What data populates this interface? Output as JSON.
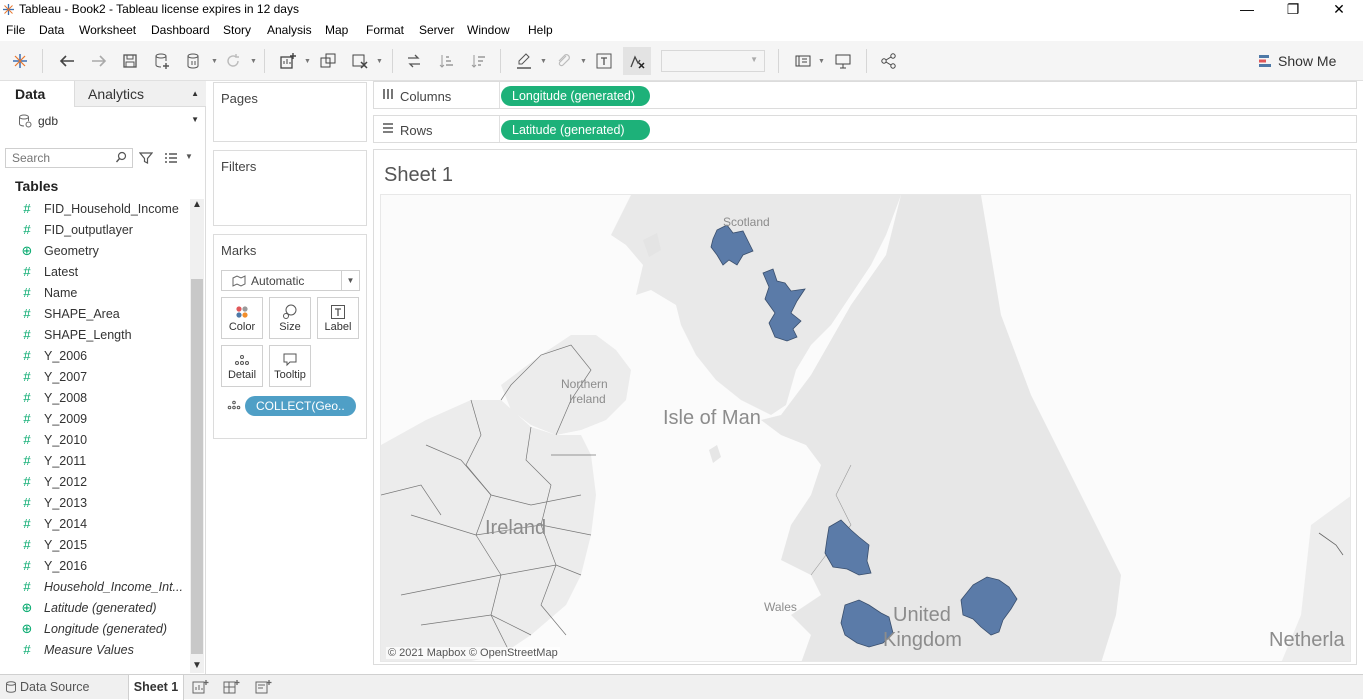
{
  "window": {
    "title": "Tableau - Book2 - Tableau license expires in 12 days",
    "minimize": "—",
    "maximize": "❐",
    "close": "✕"
  },
  "menu": [
    "File",
    "Data",
    "Worksheet",
    "Dashboard",
    "Story",
    "Analysis",
    "Map",
    "Format",
    "Server",
    "Window",
    "Help"
  ],
  "toolbar": {
    "show_me": "Show Me",
    "icons": [
      "tableau-logo-icon",
      "undo-icon",
      "redo-icon",
      "save-icon",
      "new-datasource-icon",
      "pause-updates-icon",
      "refresh-icon",
      "new-worksheet-icon",
      "duplicate-sheet-icon",
      "clear-sheet-icon",
      "swap-rows-columns-icon",
      "sort-ascending-icon",
      "sort-descending-icon",
      "highlight-icon",
      "group-members-icon",
      "show-mark-labels-icon",
      "fix-axes-icon",
      "fit-dropdown",
      "show-cards-icon",
      "presentation-mode-icon",
      "share-icon"
    ]
  },
  "data_pane": {
    "tab_data": "Data",
    "tab_analytics": "Analytics",
    "datasource": "gdb",
    "search_placeholder": "Search",
    "tables_heading": "Tables",
    "fields": [
      {
        "name": "FID_Household_Income",
        "type": "number",
        "italic": false
      },
      {
        "name": "FID_outputlayer",
        "type": "number",
        "italic": false
      },
      {
        "name": "Geometry",
        "type": "geo",
        "italic": false
      },
      {
        "name": "Latest",
        "type": "number",
        "italic": false
      },
      {
        "name": "Name",
        "type": "number",
        "italic": false
      },
      {
        "name": "SHAPE_Area",
        "type": "number",
        "italic": false
      },
      {
        "name": "SHAPE_Length",
        "type": "number",
        "italic": false
      },
      {
        "name": "Y_2006",
        "type": "number",
        "italic": false
      },
      {
        "name": "Y_2007",
        "type": "number",
        "italic": false
      },
      {
        "name": "Y_2008",
        "type": "number",
        "italic": false
      },
      {
        "name": "Y_2009",
        "type": "number",
        "italic": false
      },
      {
        "name": "Y_2010",
        "type": "number",
        "italic": false
      },
      {
        "name": "Y_2011",
        "type": "number",
        "italic": false
      },
      {
        "name": "Y_2012",
        "type": "number",
        "italic": false
      },
      {
        "name": "Y_2013",
        "type": "number",
        "italic": false
      },
      {
        "name": "Y_2014",
        "type": "number",
        "italic": false
      },
      {
        "name": "Y_2015",
        "type": "number",
        "italic": false
      },
      {
        "name": "Y_2016",
        "type": "number",
        "italic": false
      },
      {
        "name": "Household_Income_Int...",
        "type": "number",
        "italic": true
      },
      {
        "name": "Latitude (generated)",
        "type": "geo",
        "italic": true
      },
      {
        "name": "Longitude (generated)",
        "type": "geo",
        "italic": true
      },
      {
        "name": "Measure Values",
        "type": "number",
        "italic": true
      }
    ]
  },
  "cards": {
    "pages": "Pages",
    "filters": "Filters",
    "marks": "Marks",
    "mark_type": "Automatic",
    "buttons": [
      "Color",
      "Size",
      "Label",
      "Detail",
      "Tooltip"
    ],
    "collect_pill": "COLLECT(Geo.."
  },
  "shelves": {
    "columns_label": "Columns",
    "columns_pill": "Longitude (generated)",
    "rows_label": "Rows",
    "rows_pill": "Latitude (generated)"
  },
  "view": {
    "sheet_title": "Sheet 1",
    "map_labels": {
      "scotland": "Scotland",
      "northern_ireland_1": "Northern",
      "northern_ireland_2": "Ireland",
      "isle_of_man": "Isle of Man",
      "ireland": "Ireland",
      "wales": "Wales",
      "united_kingdom_1": "United",
      "united_kingdom_2": "Kingdom",
      "netherlands": "Netherla"
    },
    "attribution": "© 2021 Mapbox © OpenStreetMap",
    "region_color": "#5b7ba8"
  },
  "bottom_tabs": {
    "data_source": "Data Source",
    "sheet1": "Sheet 1"
  },
  "colors": {
    "green_pill": "#1db179",
    "blue_pill": "#4f9fc6",
    "field_icon": "#00a86b"
  }
}
